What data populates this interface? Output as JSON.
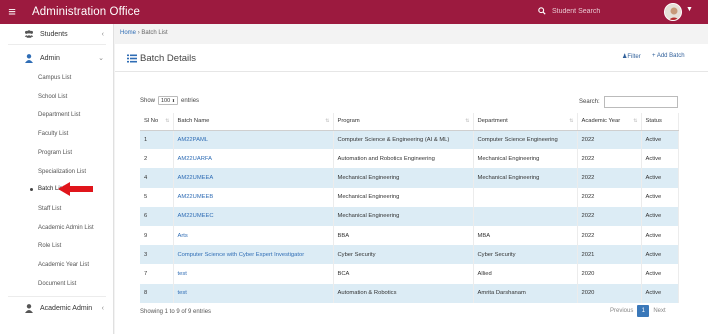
{
  "header": {
    "menu_icon": "hamburger-icon",
    "title": "Administration Office",
    "search_placeholder": "Student Search",
    "colors": {
      "brand": "#9c1a3f"
    }
  },
  "sidebar": {
    "sections": [
      {
        "label": "Students",
        "icon": "users-icon",
        "chevron": "‹"
      },
      {
        "label": "Admin",
        "icon": "user-icon",
        "chevron": "⌄"
      },
      {
        "label": "Academic Admin",
        "icon": "user-icon",
        "chevron": "‹"
      }
    ],
    "admin_items": [
      "Campus List",
      "School List",
      "Department List",
      "Faculty List",
      "Program List",
      "Specialization List",
      "Batch List",
      "Staff List",
      "Academic Admin List",
      "Role List",
      "Academic Year List",
      "Document List"
    ],
    "active_item": "Batch List"
  },
  "breadcrumb": {
    "home": "Home",
    "sep": "›",
    "current": "Batch List"
  },
  "card": {
    "title": "Batch Details",
    "filter_label": "Filter",
    "add_label": "+ Add Batch"
  },
  "table_controls": {
    "show_label": "Show",
    "entries_value": "100",
    "entries_label": "entries",
    "search_label": "Search:"
  },
  "table": {
    "columns": [
      "Sl No",
      "Batch Name",
      "Program",
      "Department",
      "Academic Year",
      "Status"
    ],
    "rows": [
      [
        "1",
        "AM22PAML",
        "Computer Science & Engineering (AI & ML)",
        "Computer Science Engineering",
        "2022",
        "Active"
      ],
      [
        "2",
        "AM22UARFA",
        "Automation and Robotics Engineering",
        "Mechanical Engineering",
        "2022",
        "Active"
      ],
      [
        "4",
        "AM22UMEEA",
        "Mechanical Engineering",
        "Mechanical Engineering",
        "2022",
        "Active"
      ],
      [
        "5",
        "AM22UMEEB",
        "Mechanical Engineering",
        "",
        "2022",
        "Active"
      ],
      [
        "6",
        "AM22UMEEC",
        "Mechanical Engineering",
        "",
        "2022",
        "Active"
      ],
      [
        "9",
        "Arts",
        "BBA",
        "MBA",
        "2022",
        "Active"
      ],
      [
        "3",
        "Computer Science with Cyber Expert Investigator",
        "Cyber Security",
        "Cyber Security",
        "2021",
        "Active"
      ],
      [
        "7",
        "test",
        "BCA",
        "Allied",
        "2020",
        "Active"
      ],
      [
        "8",
        "test",
        "Automation & Robotics",
        "Amrita Darshanam",
        "2020",
        "Active"
      ]
    ],
    "info": "Showing 1 to 9 of 9 entries"
  },
  "pagination": {
    "prev": "Previous",
    "current": "1",
    "next": "Next"
  }
}
